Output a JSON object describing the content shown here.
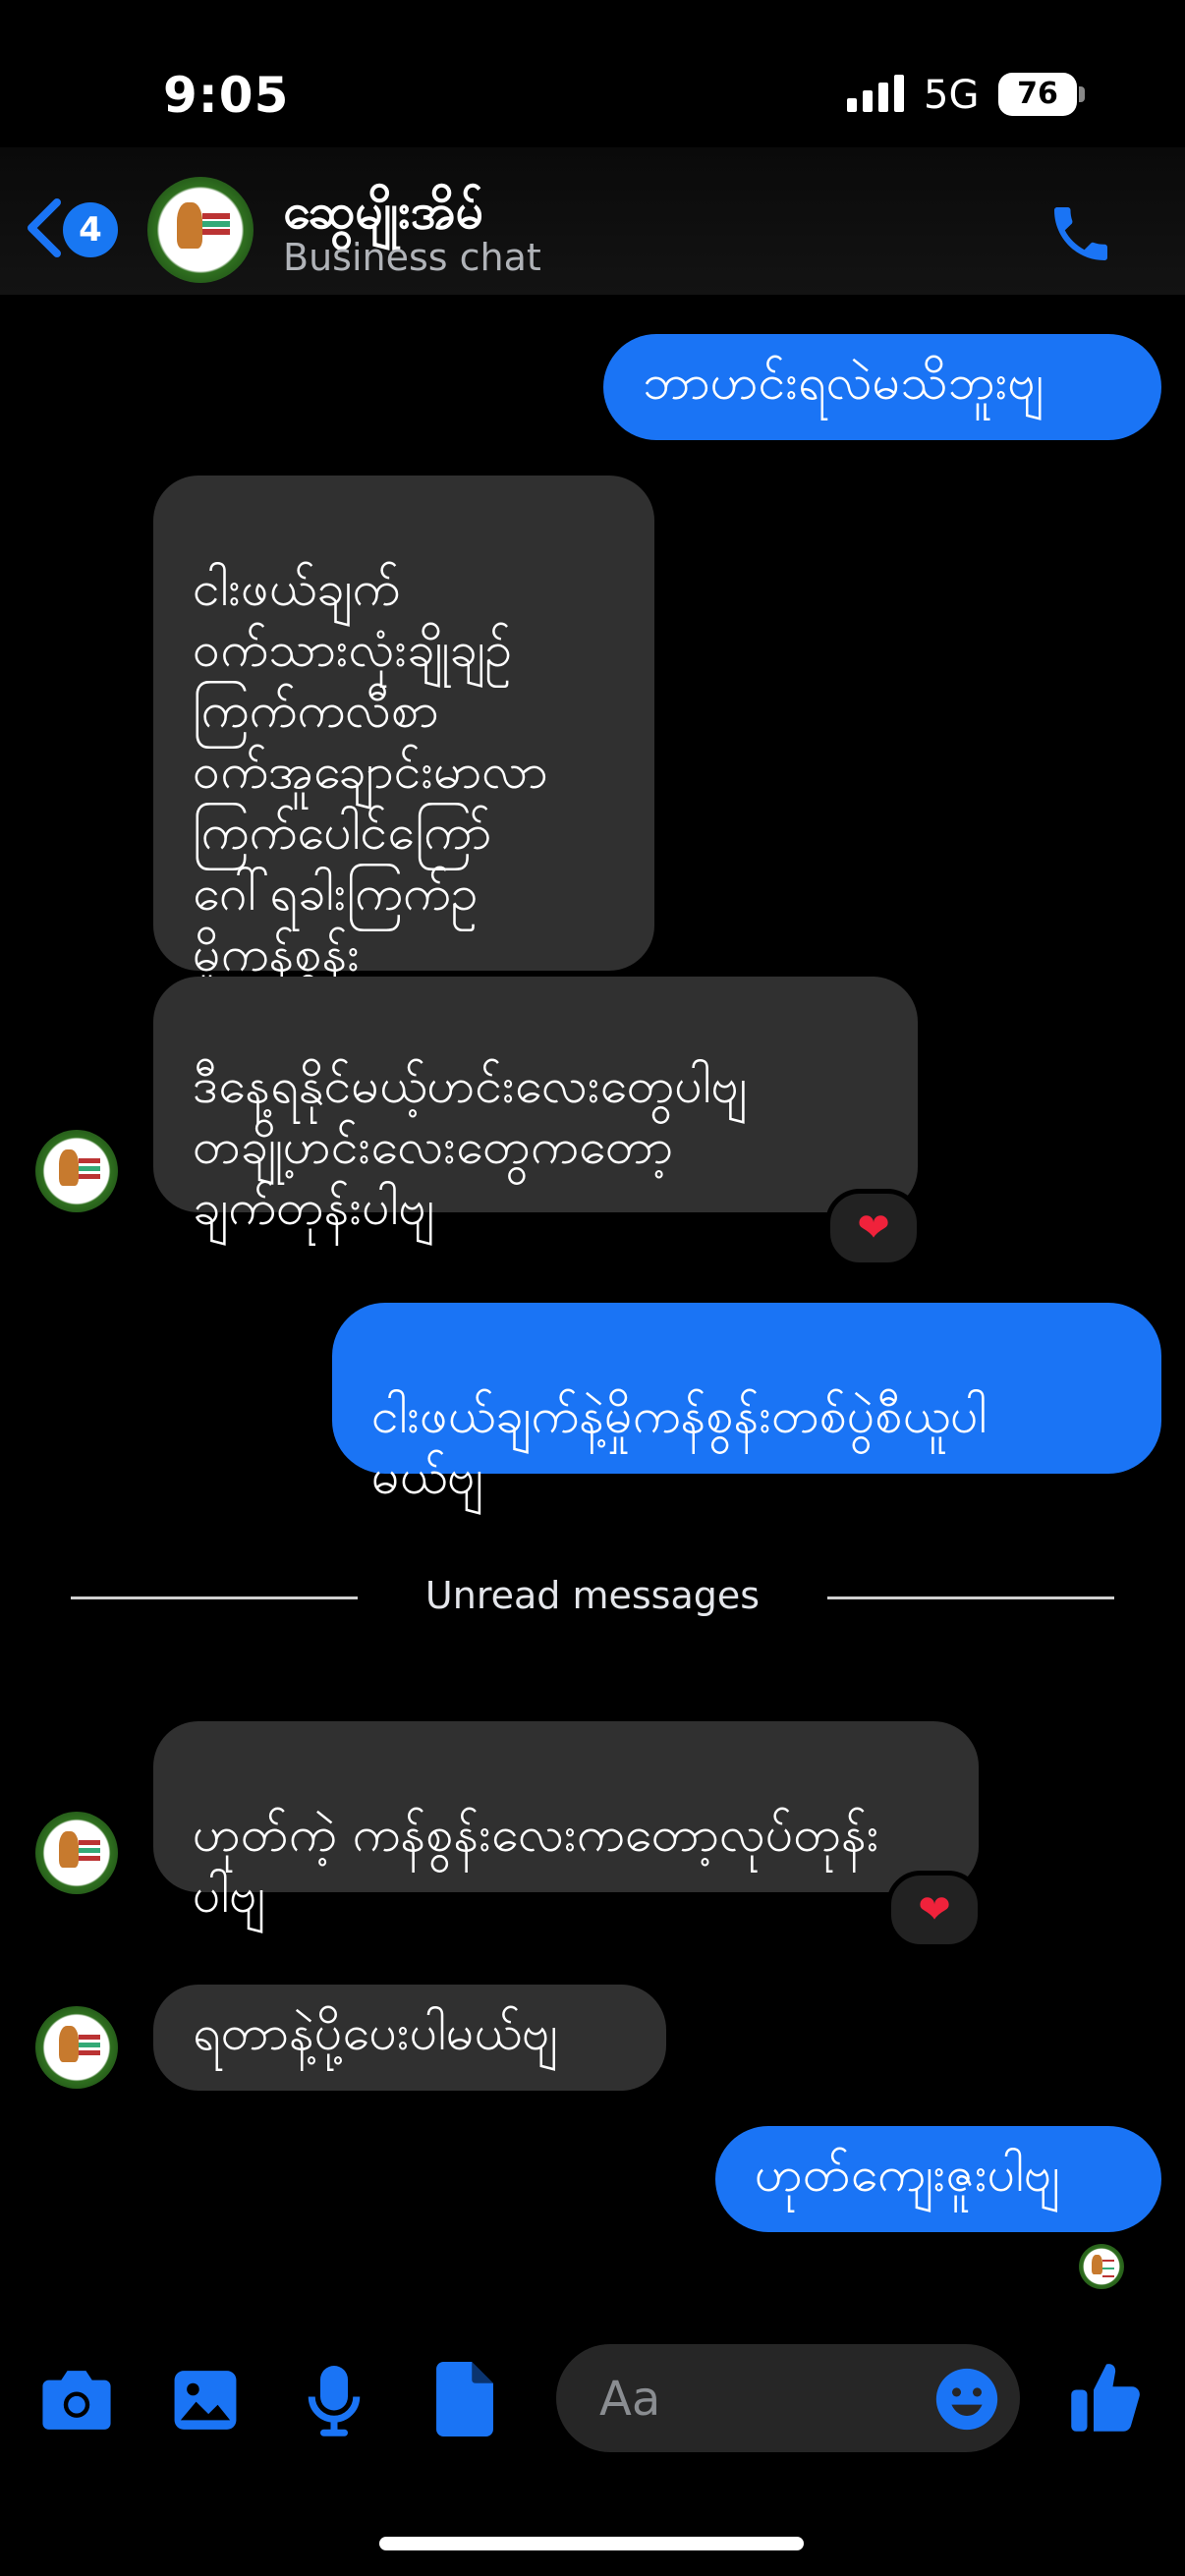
{
  "status_bar": {
    "time": "9:05",
    "network": "5G",
    "battery": "76"
  },
  "header": {
    "back_badge_count": "4",
    "contact_name": "ဆွေမျိုးအိမ်",
    "subtitle": "Business chat"
  },
  "messages": [
    {
      "direction": "outgoing",
      "text": "ဘာဟင်းရလဲမသိဘူးဗျ"
    },
    {
      "direction": "incoming",
      "text": "ငါးဖယ်ချက်\nဝက်သားလုံးချိုချဉ်\nကြက်ကလီစာ\nဝက်အူချောင်းမာလာ\nကြက်ပေါင်ကြော်\nဂေါ်ရခါးကြက်ဥ\nမှိုကန်စွန်း"
    },
    {
      "direction": "incoming",
      "text": "ဒီနေ့ရနိုင်မယ့်ဟင်းလေးတွေပါဗျ\nတချို့ဟင်းလေးတွေကတော့\nချက်တုန်းပါဗျ",
      "reaction": "❤"
    },
    {
      "direction": "outgoing",
      "text": "ငါးဖယ်ချက်နဲ့မှိုကန်စွန်းတစ်ပွဲစီယူပါ\nမယ်ဗျ"
    },
    {
      "direction": "incoming",
      "text": "ဟုတ်ကဲ့ ကန်စွန်းလေးကတော့လုပ်တုန်း\nပါဗျ",
      "reaction": "❤"
    },
    {
      "direction": "incoming",
      "text": "ရတာနဲ့ပို့ပေးပါမယ်ဗျ"
    },
    {
      "direction": "outgoing",
      "text": "ဟုတ်ကျေးဇူးပါဗျ"
    }
  ],
  "divider": {
    "label": "Unread messages"
  },
  "composer": {
    "placeholder": "Aa"
  },
  "colors": {
    "accent": "#1a74f5",
    "incoming_bubble": "#303030",
    "background": "#000000"
  },
  "icons": [
    "back-chevron-icon",
    "phone-icon",
    "camera-icon",
    "gallery-icon",
    "microphone-icon",
    "document-icon",
    "emoji-icon",
    "thumbs-up-icon"
  ]
}
